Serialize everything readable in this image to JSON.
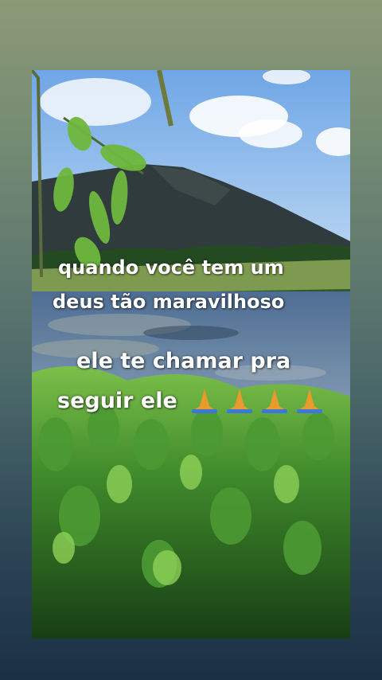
{
  "story": {
    "caption_lines": [
      "quando você tem um",
      "deus tão maravilhoso",
      "ele te chamar pra",
      "seguir ele"
    ],
    "emoji": "praying-hands-icon",
    "emoji_count": 4
  }
}
